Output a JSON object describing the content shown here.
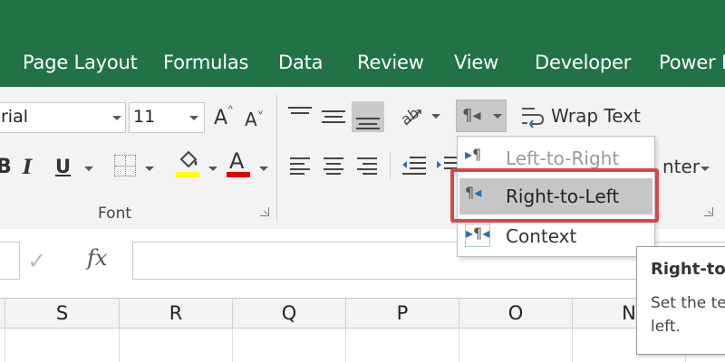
{
  "tabs": [
    "Page Layout",
    "Formulas",
    "Data",
    "Review",
    "View",
    "Developer",
    "Power P"
  ],
  "font": {
    "name_value": "rial",
    "size_value": "11",
    "group_label": "Font",
    "bold_label": "B",
    "italic_label": "I",
    "underline_label": "U",
    "font_color_label": "A",
    "increase_font_label": "A",
    "decrease_font_label": "A",
    "fill_color": "#ffff00",
    "font_color": "#e00000"
  },
  "alignment": {
    "wrap_text_label": "Wrap Text",
    "merge_center_partial": "nter"
  },
  "formula_bar": {
    "fx_label": "fx",
    "enter_icon": "check-icon"
  },
  "text_direction_menu": {
    "items": [
      {
        "label": "Left-to-Right",
        "icon": "ltr-paragraph-icon",
        "state": "disabled"
      },
      {
        "label": "Right-to-Left",
        "icon": "rtl-paragraph-icon",
        "state": "hovered"
      },
      {
        "label": "Context",
        "icon": "context-paragraph-icon",
        "state": "normal"
      }
    ]
  },
  "tooltip": {
    "title": "Right-to",
    "body_line1": "Set the te",
    "body_line2": "left."
  },
  "columns": [
    "S",
    "R",
    "Q",
    "P",
    "O",
    "N"
  ],
  "colors": {
    "title_bar": "#217346",
    "ribbon": "#f3f3f3",
    "highlight": "#d9464a"
  }
}
